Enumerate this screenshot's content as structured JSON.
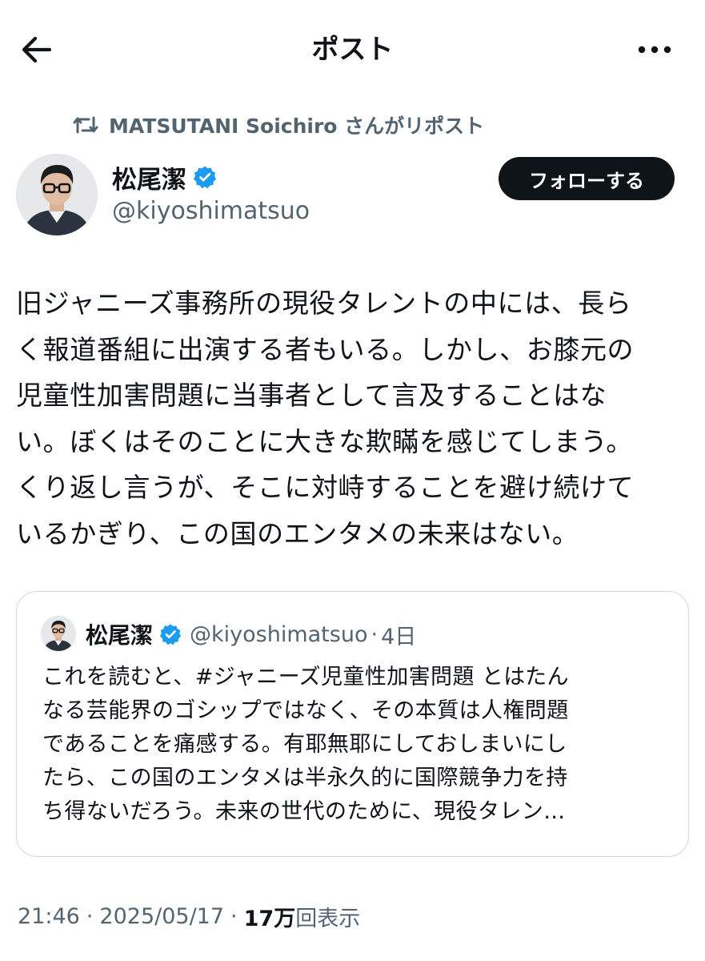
{
  "header": {
    "title": "ポスト",
    "back_icon": "arrow-left-icon",
    "more_icon": "more-horizontal-icon"
  },
  "repost": {
    "text": "MATSUTANI Soichiro さんがリポスト",
    "icon": "repost-icon"
  },
  "author": {
    "name": "松尾潔",
    "handle": "@kiyoshimatsuo",
    "verified": true
  },
  "follow_button": "フォローする",
  "post": {
    "lines": [
      "旧ジャニーズ事務所の現役タレントの中には、長ら",
      "く報道番組に出演する者もいる。しかし、お膝元の",
      "児童性加害問題に当事者として言及することはな",
      "い。ぼくはそのことに大きな欺瞞を感じてしまう。",
      "くり返し言うが、そこに対峙することを避け続けて",
      "いるかぎり、この国のエンタメの未来はない。"
    ]
  },
  "quote": {
    "name": "松尾潔",
    "handle": "@kiyoshimatsuo",
    "time": "4日",
    "time_sep": "·",
    "lines": [
      "これを読むと、#ジャニーズ児童性加害問題 とはたん",
      "なる芸能界のゴシップではなく、その本質は人権問題",
      "であることを痛感する。有耶無耶にしておしまいにし",
      "たら、この国のエンタメは半永久的に国際競争力を持",
      "ち得ないだろう。未来の世代のために、現役タレン…"
    ]
  },
  "meta": {
    "time": "21:46",
    "date": "2025/05/17",
    "views_count": "17万",
    "views_label": "回表示",
    "sep": "·"
  },
  "colors": {
    "text": "#0f1419",
    "secondary": "#536471",
    "verified": "#1d9bf0",
    "border": "#cfd9de"
  }
}
